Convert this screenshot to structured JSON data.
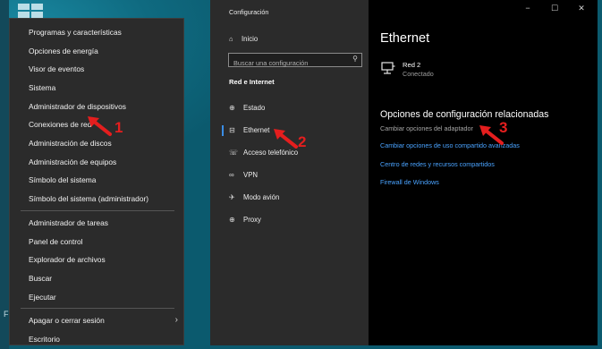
{
  "winx_menu": {
    "items": [
      "Programas y características",
      "Opciones de energía",
      "Visor de eventos",
      "Sistema",
      "Administrador de dispositivos",
      "Conexiones de red",
      "Administración de discos",
      "Administración de equipos",
      "Símbolo del sistema",
      "Símbolo del sistema (administrador)",
      "Administrador de tareas",
      "Panel de control",
      "Explorador de archivos",
      "Buscar",
      "Ejecutar",
      "Apagar o cerrar sesión",
      "Escritorio"
    ]
  },
  "desktop": {
    "marker": "F"
  },
  "settings": {
    "window_title": "Configuración",
    "home_label": "Inicio",
    "search_placeholder": "Buscar una configuración",
    "section_label": "Red e Internet",
    "nav_items": [
      {
        "label": "Estado",
        "icon": "globe-status-icon"
      },
      {
        "label": "Ethernet",
        "icon": "ethernet-icon"
      },
      {
        "label": "Acceso telefónico",
        "icon": "dialup-icon"
      },
      {
        "label": "VPN",
        "icon": "vpn-icon"
      },
      {
        "label": "Modo avión",
        "icon": "airplane-icon"
      },
      {
        "label": "Proxy",
        "icon": "globe-icon"
      }
    ],
    "window_controls": {
      "minimize": "−",
      "maximize": "☐",
      "close": "✕"
    },
    "page_title": "Ethernet",
    "network": {
      "name": "Red 2",
      "status": "Conectado"
    },
    "related_title": "Opciones de configuración relacionadas",
    "links": [
      "Cambiar opciones del adaptador",
      "Cambiar opciones de uso compartido avanzadas",
      "Centro de redes y recursos compartidos",
      "Firewall de Windows"
    ]
  },
  "annotations": [
    "1",
    "2",
    "3"
  ],
  "colors": {
    "accent": "#3a8ee6",
    "link": "#4aa3ff",
    "annotation": "#e41e1e"
  }
}
